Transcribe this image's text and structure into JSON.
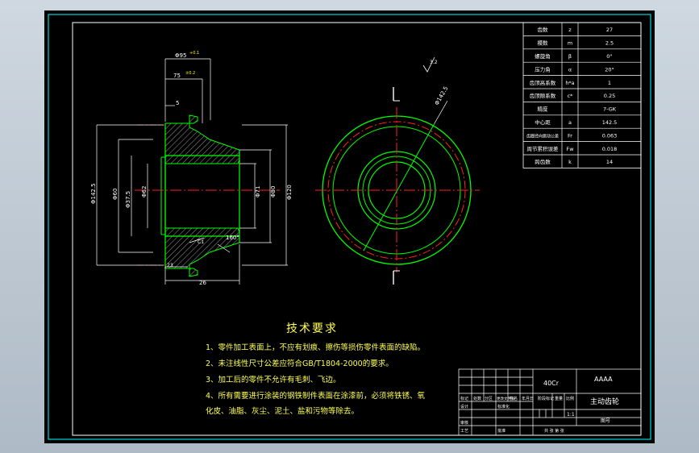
{
  "gear_params": [
    {
      "name": "齿数",
      "symbol": "z",
      "value": "27"
    },
    {
      "name": "模数",
      "symbol": "m",
      "value": "2.5"
    },
    {
      "name": "螺旋角",
      "symbol": "β",
      "value": "0°"
    },
    {
      "name": "压力角",
      "symbol": "α",
      "value": "20°"
    },
    {
      "name": "齿顶高系数",
      "symbol": "h*a",
      "value": "1"
    },
    {
      "name": "齿顶隙系数",
      "symbol": "c*",
      "value": "0.25"
    },
    {
      "name": "精度",
      "symbol": "",
      "value": "7-GK"
    },
    {
      "name": "中心距",
      "symbol": "a",
      "value": "142.5"
    },
    {
      "name": "齿圈径向跳动公差",
      "symbol": "Fr",
      "value": "0.063"
    },
    {
      "name": "周节累积误差",
      "symbol": "Fw",
      "value": "0.018"
    },
    {
      "name": "跨齿数",
      "symbol": "k",
      "value": "14"
    }
  ],
  "dimensions": {
    "d_top": "Φ95",
    "d_top_tol": "+0.1",
    "d_second": "75",
    "d_second_tol": "±0.2",
    "small_dim": "5",
    "d_left_outer": "Φ142.5",
    "d_bore_left": "Φ60",
    "d_bore_inner": "Φ37.5",
    "d_bore_center": "Φ62",
    "d_right_1": "Φ71",
    "d_right_2": "Φ80",
    "d_right_3": "Φ120",
    "chamfer_angle": "160°",
    "chamfer": "C1",
    "bottom_small": "23",
    "length": "26",
    "circle_label": "Φ142.5",
    "roughness": "3.2"
  },
  "tech_requirements": {
    "title": "技术要求",
    "items": [
      "1、零件加工表面上，不应有划痕、擦伤等损伤零件表面的缺陷。",
      "2、未注线性尺寸公差应符合GB/T1804-2000的要求。",
      "3、加工后的零件不允许有毛刺、飞边。",
      "4、所有需要进行涂装的钢铁制件表面在涂漆前，必须将铁锈、氧",
      "化皮、油脂、灰尘、泥土、盐和污物等除去。"
    ]
  },
  "title_block": {
    "material": "40Cr",
    "company": "AAAA",
    "part_name": "主动齿轮",
    "drawing_no": "图号",
    "scale": "1:1",
    "headers": [
      "标记",
      "处数",
      "分区",
      "更改文件号",
      "签名",
      "年月日"
    ],
    "row_labels": [
      "设计",
      "标准化",
      "审核",
      "工艺",
      "批准"
    ],
    "stage_label": "阶段标记",
    "weight_label": "重量",
    "ratio_label": "比例",
    "sheet_label": "共 张 第 张"
  },
  "colors": {
    "sheet": "#000000",
    "border": "#ffffff",
    "part": "#00ff00",
    "text": "#ffff00",
    "centerline": "#ff2020",
    "dimension": "#ffffff",
    "hatch": "#a0a0a0"
  }
}
